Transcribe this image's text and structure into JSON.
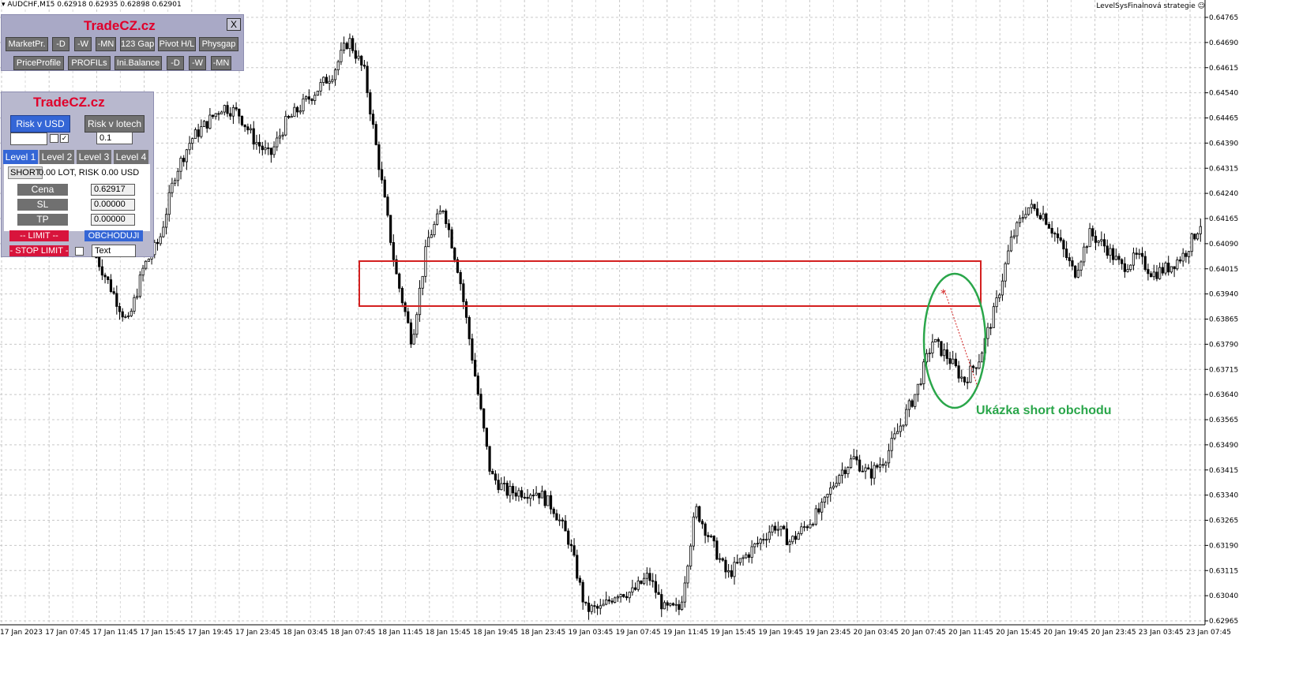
{
  "window": {
    "symbol_info": "AUDCHF,M15  0.62918 0.62935 0.62898 0.62901",
    "strategy_name": "LevelSysFinalnová strategie"
  },
  "panel_top": {
    "brand": "TradeCZ.cz",
    "close_label": "X",
    "row1": [
      "MarketPr.",
      "-D",
      "-W",
      "-MN",
      "123 Gap",
      "Pivot H/L",
      "Physgap"
    ],
    "row2": [
      "PriceProfile",
      "PROFILs",
      "Ini.Balance",
      "-D",
      "-W",
      "-MN"
    ]
  },
  "panel_trade": {
    "brand": "TradeCZ.cz",
    "risk_usd_label": "Risk v USD",
    "risk_lot_label": "Risk v lotech",
    "risk_usd_value": "",
    "checkbox_checked_mark": "✓",
    "lot_value": "0.1",
    "tabs": [
      "Level 1",
      "Level 2",
      "Level 3",
      "Level 4"
    ],
    "short_label": "SHORT",
    "lot_info": "0.00 LOT, RISK 0.00 USD",
    "price_label": "Cena",
    "price_value": "0.62917",
    "sl_label": "SL",
    "sl_value": "0.00000",
    "tp_label": "TP",
    "tp_value": "0.00000",
    "limit_label": "-- LIMIT --",
    "obchoduji_label": "OBCHODUJI",
    "stop_limit_label": "- STOP LIMIT -",
    "text_input_value": "Text"
  },
  "annotation": {
    "text": "Ukázka short obchodu",
    "rect_color": "#d42020",
    "ellipse_color": "#2aa64a",
    "marker": "*"
  },
  "chart_data": {
    "type": "candlestick",
    "symbol": "AUDCHF",
    "timeframe": "M15",
    "ylim": [
      0.6296,
      0.6479
    ],
    "y_ticks": [
      "0.64765",
      "0.64690",
      "0.64615",
      "0.64540",
      "0.64465",
      "0.64390",
      "0.64315",
      "0.64240",
      "0.64165",
      "0.64090",
      "0.64015",
      "0.63940",
      "0.63865",
      "0.63790",
      "0.63715",
      "0.63640",
      "0.63565",
      "0.63490",
      "0.63415",
      "0.63340",
      "0.63265",
      "0.63190",
      "0.63115",
      "0.63040",
      "0.62965"
    ],
    "x_ticks": [
      "17 Jan 2023",
      "17 Jan 07:45",
      "17 Jan 11:45",
      "17 Jan 15:45",
      "17 Jan 19:45",
      "17 Jan 23:45",
      "18 Jan 03:45",
      "18 Jan 07:45",
      "18 Jan 11:45",
      "18 Jan 15:45",
      "18 Jan 19:45",
      "18 Jan 23:45",
      "19 Jan 03:45",
      "19 Jan 07:45",
      "19 Jan 11:45",
      "19 Jan 15:45",
      "19 Jan 19:45",
      "19 Jan 23:45",
      "20 Jan 03:45",
      "20 Jan 07:45",
      "20 Jan 11:45",
      "20 Jan 15:45",
      "20 Jan 19:45",
      "20 Jan 23:45",
      "23 Jan 03:45",
      "23 Jan 07:45"
    ],
    "close_path": [
      0.6405,
      0.6395,
      0.6385,
      0.6402,
      0.641,
      0.643,
      0.644,
      0.6445,
      0.645,
      0.6448,
      0.644,
      0.6435,
      0.6445,
      0.645,
      0.6455,
      0.646,
      0.647,
      0.646,
      0.643,
      0.64,
      0.638,
      0.641,
      0.642,
      0.64,
      0.637,
      0.634,
      0.6335,
      0.6335,
      0.6335,
      0.633,
      0.632,
      0.63,
      0.63,
      0.6305,
      0.6305,
      0.631,
      0.63,
      0.63,
      0.633,
      0.632,
      0.631,
      0.6315,
      0.632,
      0.6325,
      0.632,
      0.6325,
      0.633,
      0.634,
      0.6345,
      0.634,
      0.6345,
      0.6355,
      0.6365,
      0.638,
      0.6375,
      0.6368,
      0.6375,
      0.639,
      0.641,
      0.642,
      0.6418,
      0.641,
      0.64,
      0.6412,
      0.6408,
      0.6402,
      0.6405,
      0.64,
      0.6402,
      0.6406,
      0.6415
    ],
    "highlight_zone": [
      0.6392,
      0.6405
    ],
    "annotation": "Ukázka short obchodu"
  }
}
